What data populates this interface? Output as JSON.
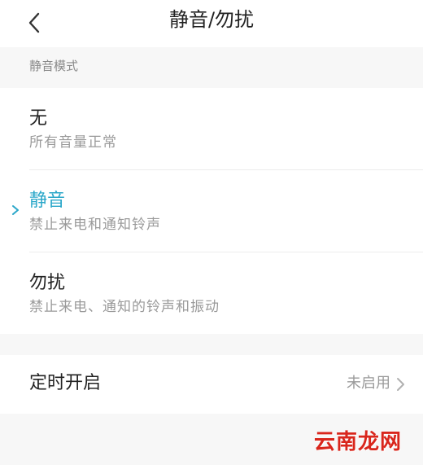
{
  "header": {
    "title": "静音/勿扰"
  },
  "section": {
    "label": "静音模式"
  },
  "options": [
    {
      "name": "无",
      "desc": "所有音量正常",
      "selected": false
    },
    {
      "name": "静音",
      "desc": "禁止来电和通知铃声",
      "selected": true
    },
    {
      "name": "勿扰",
      "desc": "禁止来电、通知的铃声和振动",
      "selected": false
    }
  ],
  "timer": {
    "label": "定时开启",
    "value": "未启用"
  },
  "watermark": "云南龙网",
  "colors": {
    "accent": "#2aa7c9",
    "text": "#222222",
    "secondary": "#9a9a9a"
  }
}
